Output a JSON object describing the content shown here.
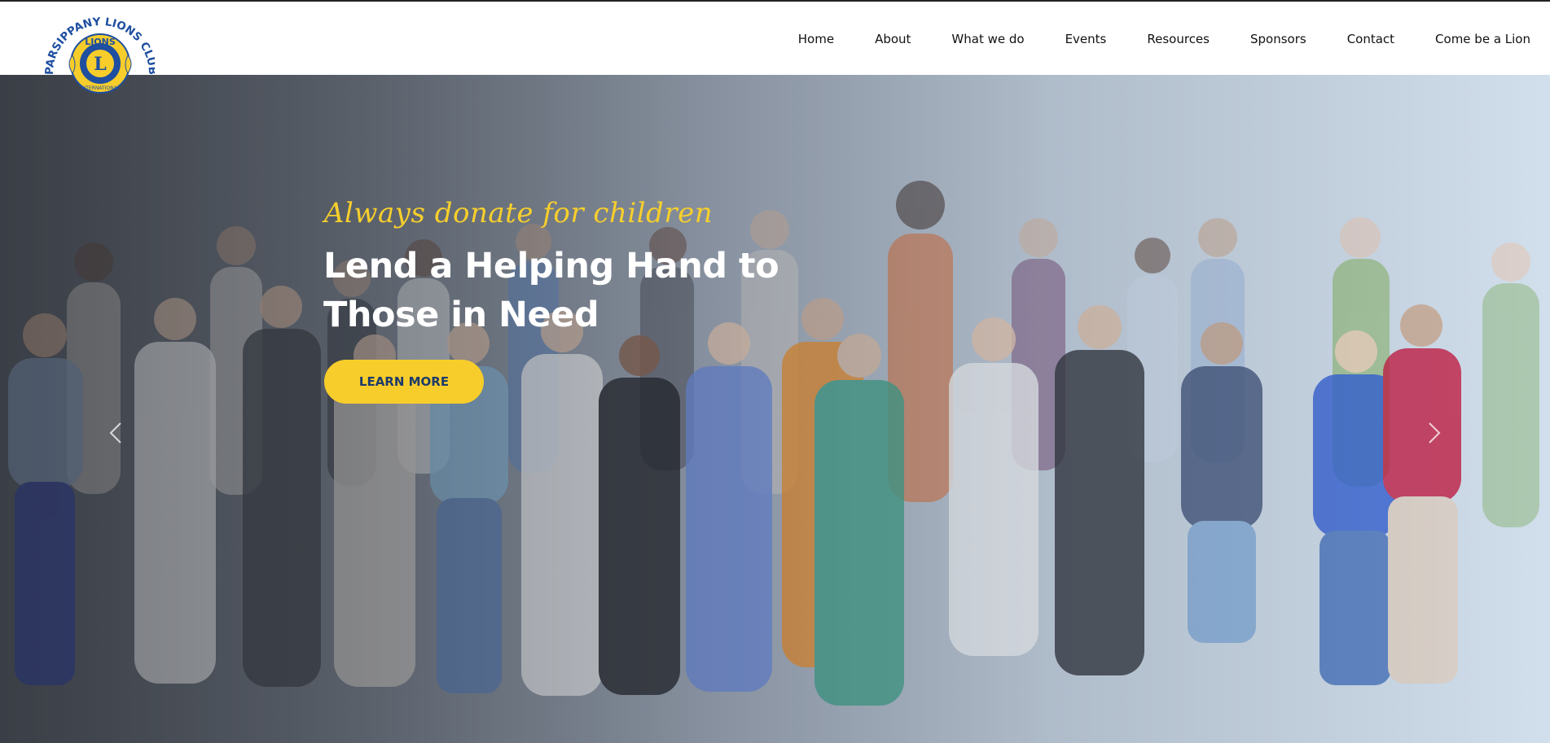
{
  "logo": {
    "arc_text": "PARSIPPANY LIONS CLUB",
    "emblem_top": "LIONS",
    "emblem_letter": "L",
    "emblem_bottom": "INTERNATIONAL"
  },
  "nav": {
    "items": [
      {
        "label": "Home"
      },
      {
        "label": "About"
      },
      {
        "label": "What we do"
      },
      {
        "label": "Events"
      },
      {
        "label": "Resources"
      },
      {
        "label": "Sponsors"
      },
      {
        "label": "Contact"
      },
      {
        "label": "Come be a Lion"
      }
    ]
  },
  "hero": {
    "tagline": "Always donate for children",
    "title": "Lend a Helping Hand to Those in Need",
    "button_label": "LEARN MORE",
    "prev_icon": "chevron-left-icon",
    "next_icon": "chevron-right-icon"
  },
  "colors": {
    "accent_yellow": "#f7cd2b",
    "lions_blue": "#1e4fa0",
    "button_text": "#1d3b6a"
  }
}
